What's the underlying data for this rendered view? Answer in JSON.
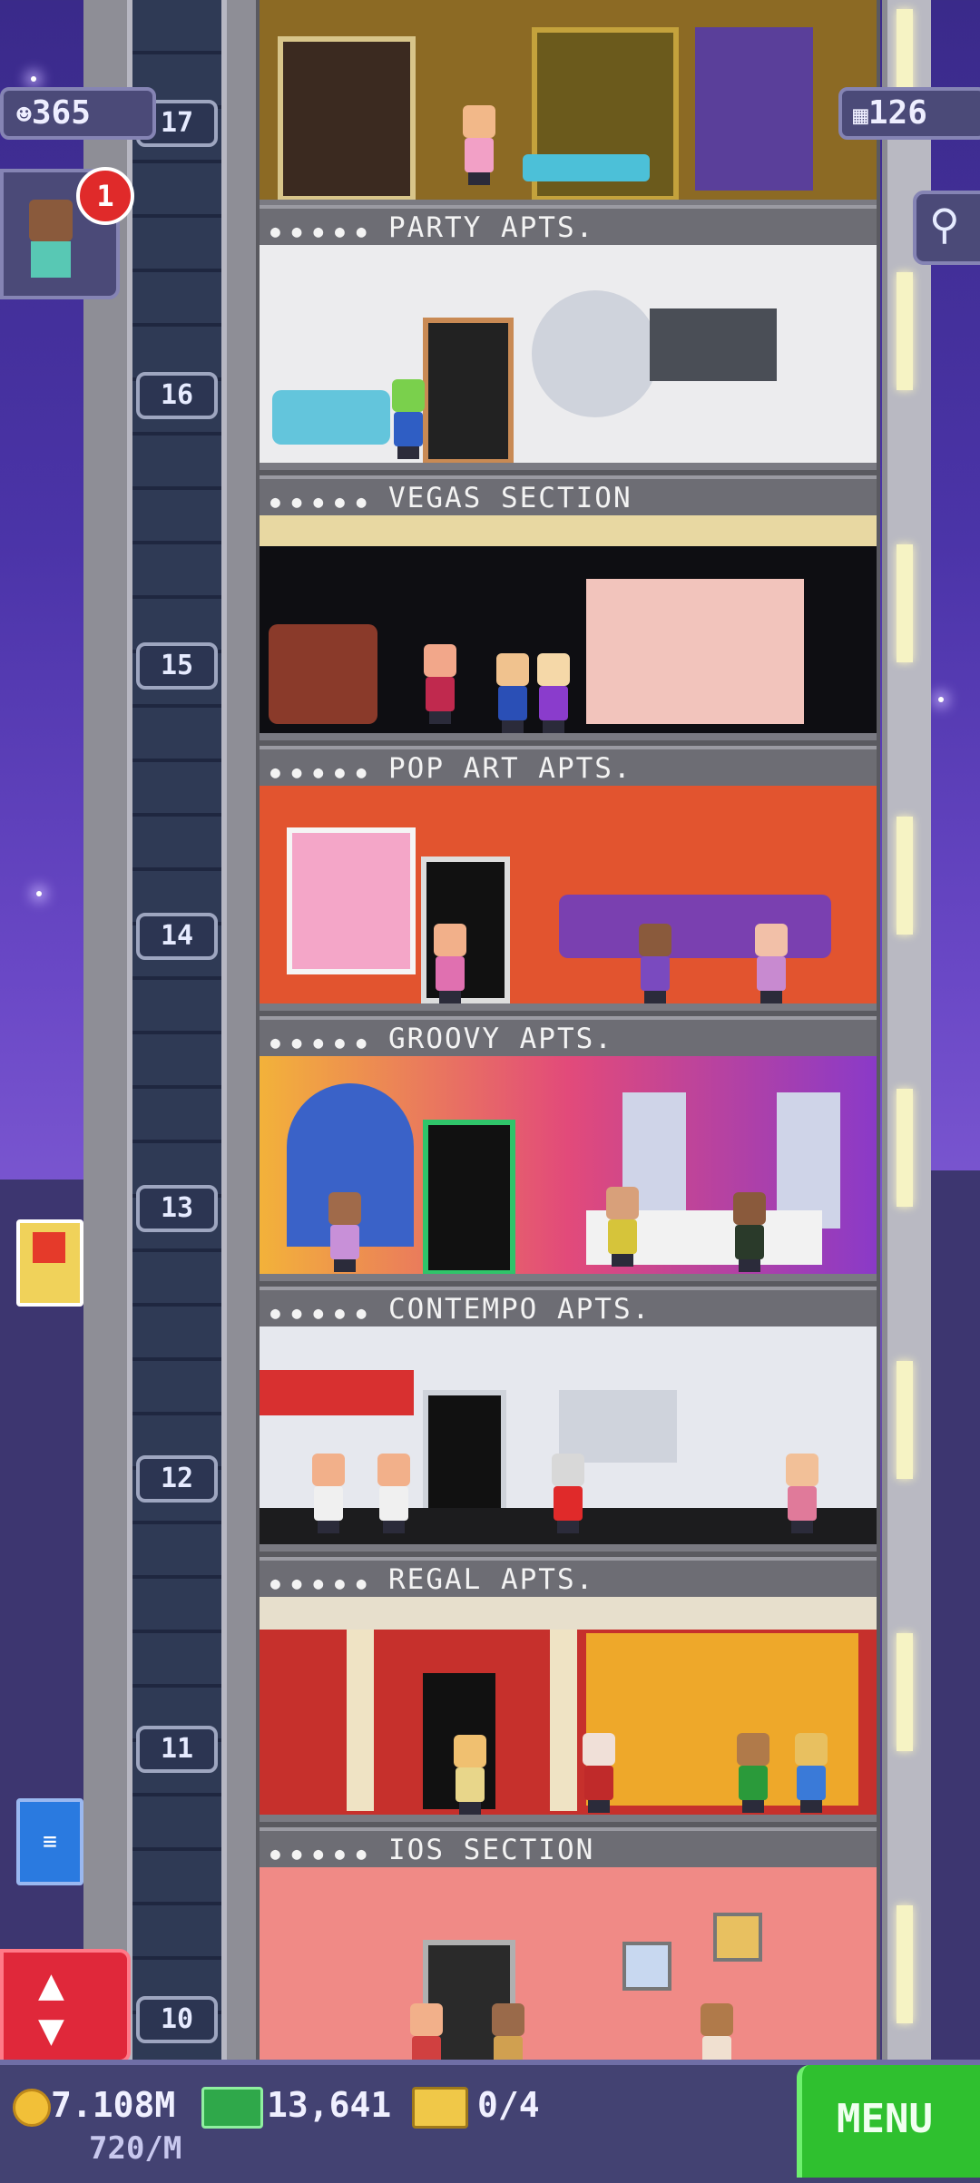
{
  "hud": {
    "population": "365",
    "floors_count": "126",
    "notification_count": "1"
  },
  "floors": [
    {
      "number": "17",
      "banner": "PARTY APTS.",
      "bg": "#c79a3a"
    },
    {
      "number": "16",
      "banner": "VEGAS SECTION",
      "bg": "#e8e8ea"
    },
    {
      "number": "15",
      "banner": "POP ART APTS.",
      "bg": "#0e0e12"
    },
    {
      "number": "14",
      "banner": "GROOVY APTS.",
      "bg": "#e2542f"
    },
    {
      "number": "13",
      "banner": "CONTEMPO APTS.",
      "bg": "#d93a5a"
    },
    {
      "number": "12",
      "banner": "REGAL APTS.",
      "bg": "#e6e8ee"
    },
    {
      "number": "11",
      "banner": "IOS SECTION",
      "bg": "#c6302c"
    },
    {
      "number": "10",
      "banner": "",
      "bg": "#f08a86"
    }
  ],
  "bottom_bar": {
    "coins": "7.108M",
    "coin_rate": "720/M",
    "bux": "13,641",
    "tickets": "0/4",
    "menu_label": "MENU"
  }
}
